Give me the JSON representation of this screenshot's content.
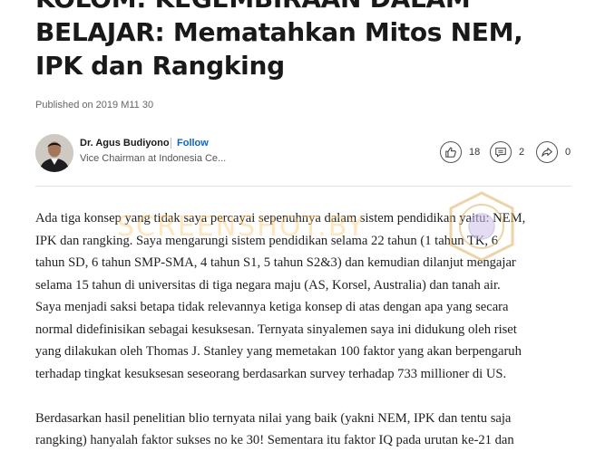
{
  "article": {
    "title_lines": [
      "KOLOM: KEGEMBIRAAN DALAM",
      "BELAJAR: Mematahkan Mitos NEM,",
      "IPK dan Rangking"
    ],
    "published": "Published on 2019 M11 30"
  },
  "author": {
    "name": "Dr. Agus Budiyono",
    "follow_label": "Follow",
    "headline": "Vice Chairman at Indonesia Ce..."
  },
  "social": {
    "likes": "18",
    "comments": "2",
    "shares": "0",
    "like_icon": "thumbs-up-icon",
    "comment_icon": "comment-icon",
    "share_icon": "share-icon"
  },
  "body": {
    "paragraph_1_lines": [
      "Ada tiga konsep yang tidak saya percayai sepenuhnya dalam sistem pendidikan yaitu: NEM,",
      "IPK dan rangking. Saya mengarungi sistem pendidikan selama 22 tahun (1 tahun TK, 6",
      "tahun SD, 6 tahun SMP-SMA, 4 tahun S1, 5 tahun S2&3) dan kemudian dilanjut mengajar",
      "selama 15 tahun di universitas di tiga negara maju (AS, Korsel, Australia) dan tanah air.",
      "Saya menjadi saksi betapa tidak relevannya ketiga konsep di atas dengan apa yang secara",
      "normal didefinisikan sebagai kesuksesan. Ternyata sinyalemen saya ini didukung oleh riset",
      "yang dilakukan oleh Thomas J. Stanley yang memetakan 100 faktor yang akan berpengaruh",
      "terhadap tingkat kesuksesan seseorang berdasarkan survey terhadap 733 millioner di US."
    ],
    "paragraph_2_lines": [
      "Berdasarkan hasil penelitian blio ternyata nilai yang baik (yakni NEM, IPK dan tentu saja",
      "rangking) hanyalah faktor sukses no ke 30! Sementara itu faktor IQ pada urutan ke-21 dan"
    ]
  },
  "watermark": {
    "text": "SCREENSHOT.BY"
  },
  "colors": {
    "link": "#0a66c2",
    "text": "#1f1f1f",
    "muted": "#666666",
    "watermark": "#ffc86e"
  }
}
